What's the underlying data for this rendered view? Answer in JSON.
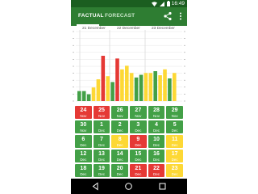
{
  "status_bar": {
    "time": "16:49",
    "icons": [
      "wifi-icon",
      "signal-icon",
      "battery-icon"
    ]
  },
  "tabs": [
    {
      "label": "FACTUAL",
      "active": true
    },
    {
      "label": "FORECAST",
      "active": false
    }
  ],
  "actions": [
    "share-icon",
    "more-vertical-icon"
  ],
  "colors": {
    "status_bar": "#1b5e20",
    "app_bar": "#2e7d32",
    "green": "#43a047",
    "yellow": "#fdd835",
    "red": "#e53935"
  },
  "chart_data": {
    "type": "bar",
    "xlabel": "",
    "ylabel": "",
    "date_labels": [
      "21 December",
      "22 December",
      "23 December"
    ],
    "ylim": [
      0,
      100
    ],
    "values": [
      22,
      22,
      15,
      30,
      48,
      100,
      55,
      42,
      94,
      70,
      78,
      62,
      52,
      58,
      62,
      62,
      66,
      57,
      70,
      50,
      62
    ],
    "levels": [
      "green",
      "green",
      "green",
      "yellow",
      "yellow",
      "red",
      "yellow",
      "green",
      "red",
      "yellow",
      "yellow",
      "yellow",
      "green",
      "green",
      "yellow",
      "yellow",
      "green",
      "yellow",
      "yellow",
      "green",
      "yellow"
    ]
  },
  "calendar": [
    {
      "day": "24",
      "month": "Nov",
      "level": "red"
    },
    {
      "day": "25",
      "month": "Nov",
      "level": "red"
    },
    {
      "day": "26",
      "month": "Nov",
      "level": "green"
    },
    {
      "day": "27",
      "month": "Nov",
      "level": "green"
    },
    {
      "day": "28",
      "month": "Nov",
      "level": "green"
    },
    {
      "day": "29",
      "month": "Nov",
      "level": "green"
    },
    {
      "day": "30",
      "month": "Nov",
      "level": "green"
    },
    {
      "day": "1",
      "month": "Dec",
      "level": "green"
    },
    {
      "day": "2",
      "month": "Dec",
      "level": "green"
    },
    {
      "day": "3",
      "month": "Dec",
      "level": "green"
    },
    {
      "day": "4",
      "month": "Dec",
      "level": "green"
    },
    {
      "day": "5",
      "month": "Dec",
      "level": "green"
    },
    {
      "day": "6",
      "month": "Dec",
      "level": "green"
    },
    {
      "day": "7",
      "month": "Dec",
      "level": "green"
    },
    {
      "day": "8",
      "month": "Dec",
      "level": "yellow"
    },
    {
      "day": "9",
      "month": "Dec",
      "level": "red"
    },
    {
      "day": "10",
      "month": "Dec",
      "level": "green"
    },
    {
      "day": "11",
      "month": "Dec",
      "level": "yellow"
    },
    {
      "day": "12",
      "month": "Dec",
      "level": "green"
    },
    {
      "day": "13",
      "month": "Dec",
      "level": "green"
    },
    {
      "day": "14",
      "month": "Dec",
      "level": "green"
    },
    {
      "day": "15",
      "month": "Dec",
      "level": "green"
    },
    {
      "day": "16",
      "month": "Dec",
      "level": "green"
    },
    {
      "day": "17",
      "month": "Dec",
      "level": "yellow"
    },
    {
      "day": "18",
      "month": "Dec",
      "level": "green"
    },
    {
      "day": "19",
      "month": "Dec",
      "level": "green"
    },
    {
      "day": "20",
      "month": "Dec",
      "level": "green"
    },
    {
      "day": "21",
      "month": "Dec",
      "level": "red"
    },
    {
      "day": "22",
      "month": "Dec",
      "level": "red"
    },
    {
      "day": "23",
      "month": "Dec",
      "level": "yellow"
    }
  ],
  "nav": [
    "back-icon",
    "home-icon",
    "recents-icon"
  ]
}
